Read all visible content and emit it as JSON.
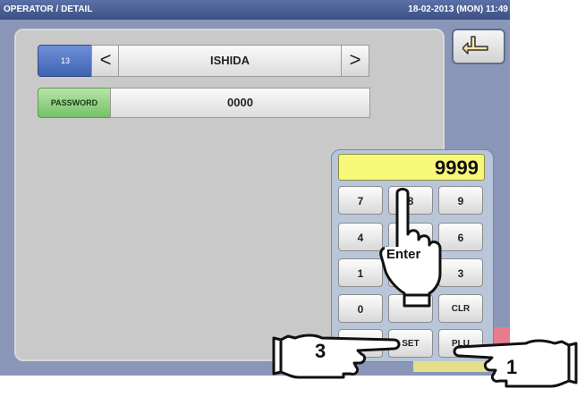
{
  "titlebar": {
    "title": "OPERATOR / DETAIL",
    "clock": "18-02-2013 (MON) 11:49"
  },
  "operator": {
    "number": "13",
    "prev_label": "<",
    "name": "ISHIDA",
    "next_label": ">"
  },
  "password": {
    "label": "PASSWORD",
    "value": "0000"
  },
  "keypad": {
    "display": "9999",
    "keys": [
      "7",
      "8",
      "9",
      "4",
      "5",
      "6",
      "1",
      "2",
      "3",
      "0",
      "",
      "CLR",
      "",
      "SET",
      "PLU"
    ]
  },
  "callouts": {
    "enter": "Enter",
    "step1": "1",
    "step3": "3"
  },
  "icons": {
    "back": "return-arrow-icon"
  },
  "colors": {
    "accent": "#3f62b3",
    "display_bg": "#f7f77a",
    "password_label": "#74c267"
  }
}
